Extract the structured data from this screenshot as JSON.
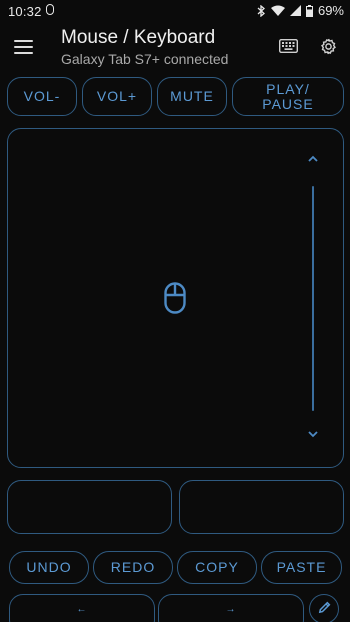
{
  "status_bar": {
    "time": "10:32",
    "battery": "69%",
    "icons": [
      "mouse-notification-icon",
      "bluetooth-icon",
      "wifi-icon",
      "signal-icon",
      "battery-icon"
    ]
  },
  "app_bar": {
    "title": "Mouse / Keyboard",
    "subtitle": "Galaxy Tab S7+ connected",
    "icons": [
      "menu-icon",
      "keyboard-icon",
      "gear-icon"
    ]
  },
  "media_buttons": [
    "VOL-",
    "VOL+",
    "MUTE",
    "PLAY/ PAUSE"
  ],
  "edit_buttons": [
    "UNDO",
    "REDO",
    "COPY",
    "PASTE"
  ],
  "arrow_buttons": [
    "←",
    "→"
  ],
  "touchpad": {
    "icons": [
      "chevron-up-icon",
      "chevron-down-icon",
      "mouse-icon"
    ]
  },
  "colors": {
    "background": "#0b0b0b",
    "accent": "#5c9ad4",
    "border": "#2f5a80",
    "text": "#f0f0f0",
    "subtext": "#a9a9a9"
  }
}
